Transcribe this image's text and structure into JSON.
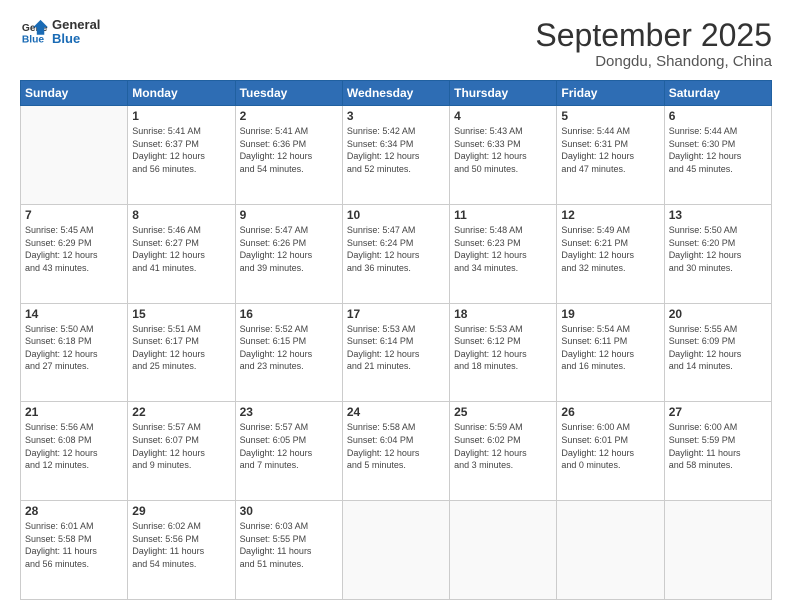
{
  "logo": {
    "line1": "General",
    "line2": "Blue"
  },
  "title": "September 2025",
  "location": "Dongdu, Shandong, China",
  "weekdays": [
    "Sunday",
    "Monday",
    "Tuesday",
    "Wednesday",
    "Thursday",
    "Friday",
    "Saturday"
  ],
  "weeks": [
    [
      {
        "day": "",
        "info": ""
      },
      {
        "day": "1",
        "info": "Sunrise: 5:41 AM\nSunset: 6:37 PM\nDaylight: 12 hours\nand 56 minutes."
      },
      {
        "day": "2",
        "info": "Sunrise: 5:41 AM\nSunset: 6:36 PM\nDaylight: 12 hours\nand 54 minutes."
      },
      {
        "day": "3",
        "info": "Sunrise: 5:42 AM\nSunset: 6:34 PM\nDaylight: 12 hours\nand 52 minutes."
      },
      {
        "day": "4",
        "info": "Sunrise: 5:43 AM\nSunset: 6:33 PM\nDaylight: 12 hours\nand 50 minutes."
      },
      {
        "day": "5",
        "info": "Sunrise: 5:44 AM\nSunset: 6:31 PM\nDaylight: 12 hours\nand 47 minutes."
      },
      {
        "day": "6",
        "info": "Sunrise: 5:44 AM\nSunset: 6:30 PM\nDaylight: 12 hours\nand 45 minutes."
      }
    ],
    [
      {
        "day": "7",
        "info": "Sunrise: 5:45 AM\nSunset: 6:29 PM\nDaylight: 12 hours\nand 43 minutes."
      },
      {
        "day": "8",
        "info": "Sunrise: 5:46 AM\nSunset: 6:27 PM\nDaylight: 12 hours\nand 41 minutes."
      },
      {
        "day": "9",
        "info": "Sunrise: 5:47 AM\nSunset: 6:26 PM\nDaylight: 12 hours\nand 39 minutes."
      },
      {
        "day": "10",
        "info": "Sunrise: 5:47 AM\nSunset: 6:24 PM\nDaylight: 12 hours\nand 36 minutes."
      },
      {
        "day": "11",
        "info": "Sunrise: 5:48 AM\nSunset: 6:23 PM\nDaylight: 12 hours\nand 34 minutes."
      },
      {
        "day": "12",
        "info": "Sunrise: 5:49 AM\nSunset: 6:21 PM\nDaylight: 12 hours\nand 32 minutes."
      },
      {
        "day": "13",
        "info": "Sunrise: 5:50 AM\nSunset: 6:20 PM\nDaylight: 12 hours\nand 30 minutes."
      }
    ],
    [
      {
        "day": "14",
        "info": "Sunrise: 5:50 AM\nSunset: 6:18 PM\nDaylight: 12 hours\nand 27 minutes."
      },
      {
        "day": "15",
        "info": "Sunrise: 5:51 AM\nSunset: 6:17 PM\nDaylight: 12 hours\nand 25 minutes."
      },
      {
        "day": "16",
        "info": "Sunrise: 5:52 AM\nSunset: 6:15 PM\nDaylight: 12 hours\nand 23 minutes."
      },
      {
        "day": "17",
        "info": "Sunrise: 5:53 AM\nSunset: 6:14 PM\nDaylight: 12 hours\nand 21 minutes."
      },
      {
        "day": "18",
        "info": "Sunrise: 5:53 AM\nSunset: 6:12 PM\nDaylight: 12 hours\nand 18 minutes."
      },
      {
        "day": "19",
        "info": "Sunrise: 5:54 AM\nSunset: 6:11 PM\nDaylight: 12 hours\nand 16 minutes."
      },
      {
        "day": "20",
        "info": "Sunrise: 5:55 AM\nSunset: 6:09 PM\nDaylight: 12 hours\nand 14 minutes."
      }
    ],
    [
      {
        "day": "21",
        "info": "Sunrise: 5:56 AM\nSunset: 6:08 PM\nDaylight: 12 hours\nand 12 minutes."
      },
      {
        "day": "22",
        "info": "Sunrise: 5:57 AM\nSunset: 6:07 PM\nDaylight: 12 hours\nand 9 minutes."
      },
      {
        "day": "23",
        "info": "Sunrise: 5:57 AM\nSunset: 6:05 PM\nDaylight: 12 hours\nand 7 minutes."
      },
      {
        "day": "24",
        "info": "Sunrise: 5:58 AM\nSunset: 6:04 PM\nDaylight: 12 hours\nand 5 minutes."
      },
      {
        "day": "25",
        "info": "Sunrise: 5:59 AM\nSunset: 6:02 PM\nDaylight: 12 hours\nand 3 minutes."
      },
      {
        "day": "26",
        "info": "Sunrise: 6:00 AM\nSunset: 6:01 PM\nDaylight: 12 hours\nand 0 minutes."
      },
      {
        "day": "27",
        "info": "Sunrise: 6:00 AM\nSunset: 5:59 PM\nDaylight: 11 hours\nand 58 minutes."
      }
    ],
    [
      {
        "day": "28",
        "info": "Sunrise: 6:01 AM\nSunset: 5:58 PM\nDaylight: 11 hours\nand 56 minutes."
      },
      {
        "day": "29",
        "info": "Sunrise: 6:02 AM\nSunset: 5:56 PM\nDaylight: 11 hours\nand 54 minutes."
      },
      {
        "day": "30",
        "info": "Sunrise: 6:03 AM\nSunset: 5:55 PM\nDaylight: 11 hours\nand 51 minutes."
      },
      {
        "day": "",
        "info": ""
      },
      {
        "day": "",
        "info": ""
      },
      {
        "day": "",
        "info": ""
      },
      {
        "day": "",
        "info": ""
      }
    ]
  ]
}
